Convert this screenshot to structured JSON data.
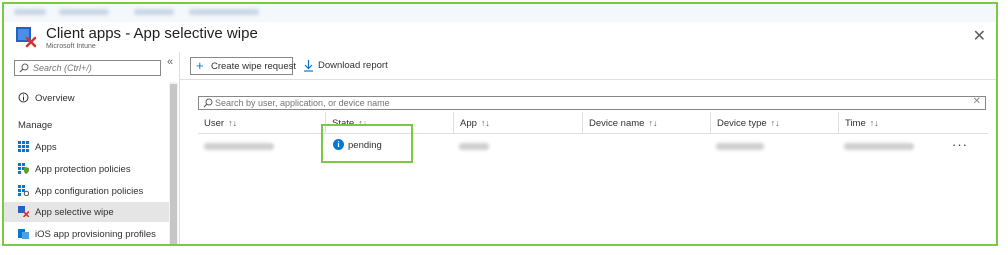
{
  "window": {
    "title": "Client apps - App selective wipe",
    "subtitle": "Microsoft Intune",
    "close_glyph": "✕"
  },
  "sidebar": {
    "search_placeholder": "Search (Ctrl+/)",
    "collapse_glyph": "«",
    "overview_label": "Overview",
    "section_manage": "Manage",
    "items": [
      {
        "label": "Apps",
        "icon": "grid-icon"
      },
      {
        "label": "App protection policies",
        "icon": "app-protection-icon"
      },
      {
        "label": "App configuration policies",
        "icon": "app-configuration-icon"
      },
      {
        "label": "App selective wipe",
        "icon": "selective-wipe-icon",
        "active": true
      },
      {
        "label": "iOS app provisioning profiles",
        "icon": "provisioning-profile-icon"
      }
    ]
  },
  "toolbar": {
    "create_label": "Create wipe request",
    "download_label": "Download report"
  },
  "filter": {
    "placeholder": "Search by user, application, or device name",
    "clear_glyph": "✕"
  },
  "table": {
    "sort_glyph": "↑↓",
    "columns": [
      "User",
      "State",
      "App",
      "Device name",
      "Device type",
      "Time"
    ],
    "rows": [
      {
        "state": "pending",
        "state_icon": "info-icon",
        "more": "···"
      }
    ]
  },
  "colors": {
    "accent": "#0078d4",
    "highlight_border": "#7ac943",
    "active_item_bg": "#e5e5e5"
  }
}
